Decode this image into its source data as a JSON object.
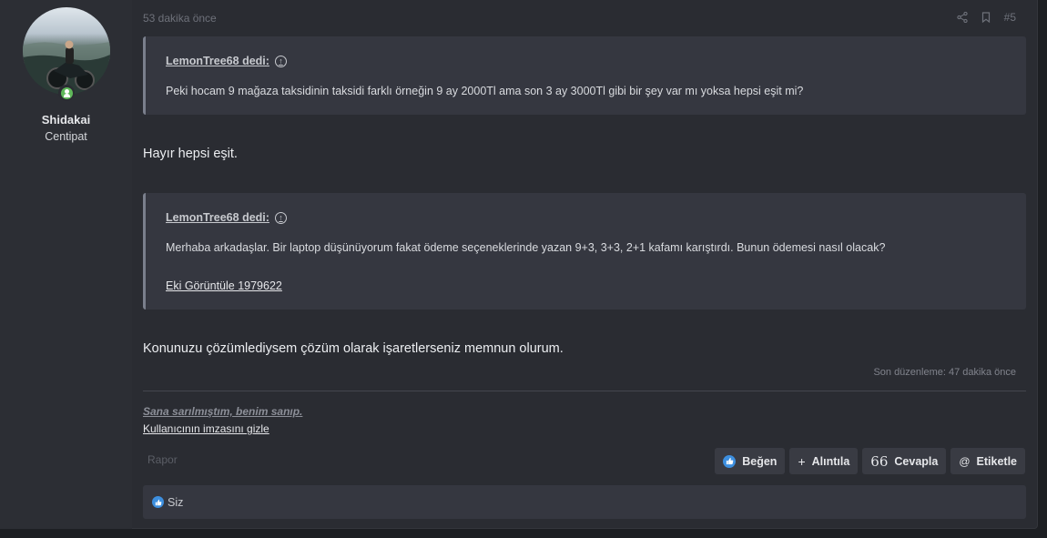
{
  "user": {
    "name": "Shidakai",
    "title": "Centipat"
  },
  "meta": {
    "time": "53 dakika önce",
    "post_number": "#5"
  },
  "quotes": [
    {
      "author": "LemonTree68 dedi:",
      "text": "Peki hocam 9 mağaza taksidinin taksidi farklı örneğin 9 ay 2000Tl ama son 3 ay 3000Tl gibi bir şey var mı yoksa hepsi eşit mi?"
    },
    {
      "author": "LemonTree68 dedi:",
      "text": "Merhaba arkadaşlar. Bir laptop düşünüyorum fakat ödeme seçeneklerinde yazan 9+3, 3+3, 2+1 kafamı karıştırdı. Bunun ödemesi nasıl olacak?",
      "attachment": "Eki Görüntüle 1979622"
    }
  ],
  "body": {
    "reply1": "Hayır hepsi eşit.",
    "reply2": "Konunuzu çözümlediysem çözüm olarak işaretlerseniz memnun olurum."
  },
  "edited": "Son düzenleme: 47 dakika önce",
  "signature": {
    "text": "Sana sarılmıştım, benim sanıp.",
    "hide_link": "Kullanıcının imzasını gizle"
  },
  "actions": {
    "report": "Rapor",
    "like": "Beğen",
    "quote": "Alıntıla",
    "reply": "Cevapla",
    "tag": "Etiketle"
  },
  "reactions": {
    "text": "Siz"
  },
  "colors": {
    "accent_like": "#3d8fdf",
    "online": "#5fb85a"
  }
}
